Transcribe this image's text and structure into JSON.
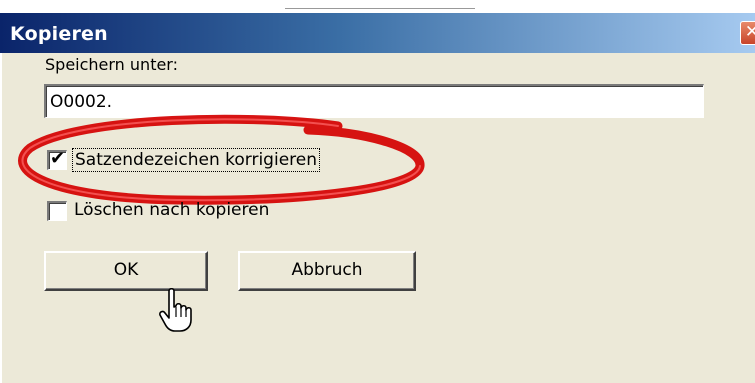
{
  "dialog": {
    "title": "Kopieren",
    "close_glyph": "✕"
  },
  "save": {
    "label": "Speichern unter:",
    "value": "O0002."
  },
  "options": [
    {
      "label": "Satzendezeichen korrigieren",
      "checked": true
    },
    {
      "label": "Löschen nach kopieren",
      "checked": false
    }
  ],
  "checkmark_glyph": "✔",
  "buttons": {
    "ok": "OK",
    "cancel": "Abbruch"
  },
  "annotation": {
    "ring_color": "#d40000",
    "target": "Satzendezeichen korrigieren"
  },
  "cursor": "hand-pointer-icon",
  "colors": {
    "title_start": "#0a246a",
    "title_end": "#a6caf0",
    "dialog_bg": "#ece9d8"
  }
}
